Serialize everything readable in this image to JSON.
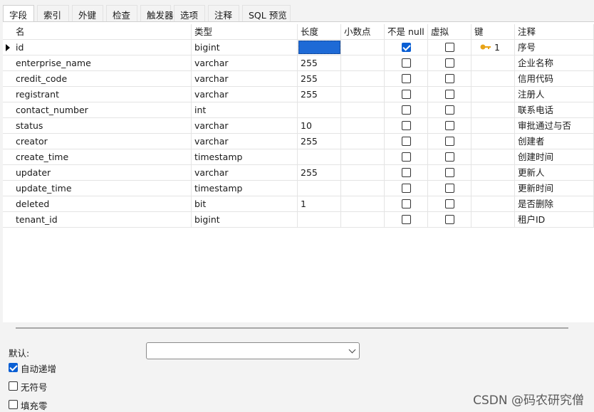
{
  "tabs": [
    "字段",
    "索引",
    "外键",
    "检查",
    "触发器",
    "选项",
    "注释",
    "SQL 预览"
  ],
  "columns": [
    "名",
    "类型",
    "长度",
    "小数点",
    "不是 null",
    "虚拟",
    "键",
    "注释"
  ],
  "rows": [
    {
      "name": "id",
      "type": "bigint",
      "length": "",
      "decimals": "",
      "not_null": true,
      "virtual": false,
      "key": "1",
      "comment": "序号"
    },
    {
      "name": "enterprise_name",
      "type": "varchar",
      "length": "255",
      "decimals": "",
      "not_null": false,
      "virtual": false,
      "key": "",
      "comment": "企业名称"
    },
    {
      "name": "credit_code",
      "type": "varchar",
      "length": "255",
      "decimals": "",
      "not_null": false,
      "virtual": false,
      "key": "",
      "comment": "信用代码"
    },
    {
      "name": "registrant",
      "type": "varchar",
      "length": "255",
      "decimals": "",
      "not_null": false,
      "virtual": false,
      "key": "",
      "comment": "注册人"
    },
    {
      "name": "contact_number",
      "type": "int",
      "length": "",
      "decimals": "",
      "not_null": false,
      "virtual": false,
      "key": "",
      "comment": "联系电话"
    },
    {
      "name": "status",
      "type": "varchar",
      "length": "10",
      "decimals": "",
      "not_null": false,
      "virtual": false,
      "key": "",
      "comment": "审批通过与否"
    },
    {
      "name": "creator",
      "type": "varchar",
      "length": "255",
      "decimals": "",
      "not_null": false,
      "virtual": false,
      "key": "",
      "comment": "创建者"
    },
    {
      "name": "create_time",
      "type": "timestamp",
      "length": "",
      "decimals": "",
      "not_null": false,
      "virtual": false,
      "key": "",
      "comment": "创建时间"
    },
    {
      "name": "updater",
      "type": "varchar",
      "length": "255",
      "decimals": "",
      "not_null": false,
      "virtual": false,
      "key": "",
      "comment": "更新人"
    },
    {
      "name": "update_time",
      "type": "timestamp",
      "length": "",
      "decimals": "",
      "not_null": false,
      "virtual": false,
      "key": "",
      "comment": "更新时间"
    },
    {
      "name": "deleted",
      "type": "bit",
      "length": "1",
      "decimals": "",
      "not_null": false,
      "virtual": false,
      "key": "",
      "comment": "是否删除"
    },
    {
      "name": "tenant_id",
      "type": "bigint",
      "length": "",
      "decimals": "",
      "not_null": false,
      "virtual": false,
      "key": "",
      "comment": "租户ID"
    }
  ],
  "bottom": {
    "default_label": "默认:",
    "default_value": "",
    "auto_increment_label": "自动递增",
    "auto_increment": true,
    "unsigned_label": "无符号",
    "unsigned": false,
    "zerofill_label": "填充零",
    "zerofill": false
  },
  "watermark": "CSDN @码农研究僧",
  "colors": {
    "selection": "#1e6ad6",
    "checkbox_checked": "#0a5fd4",
    "key_icon": "#e8a317"
  }
}
